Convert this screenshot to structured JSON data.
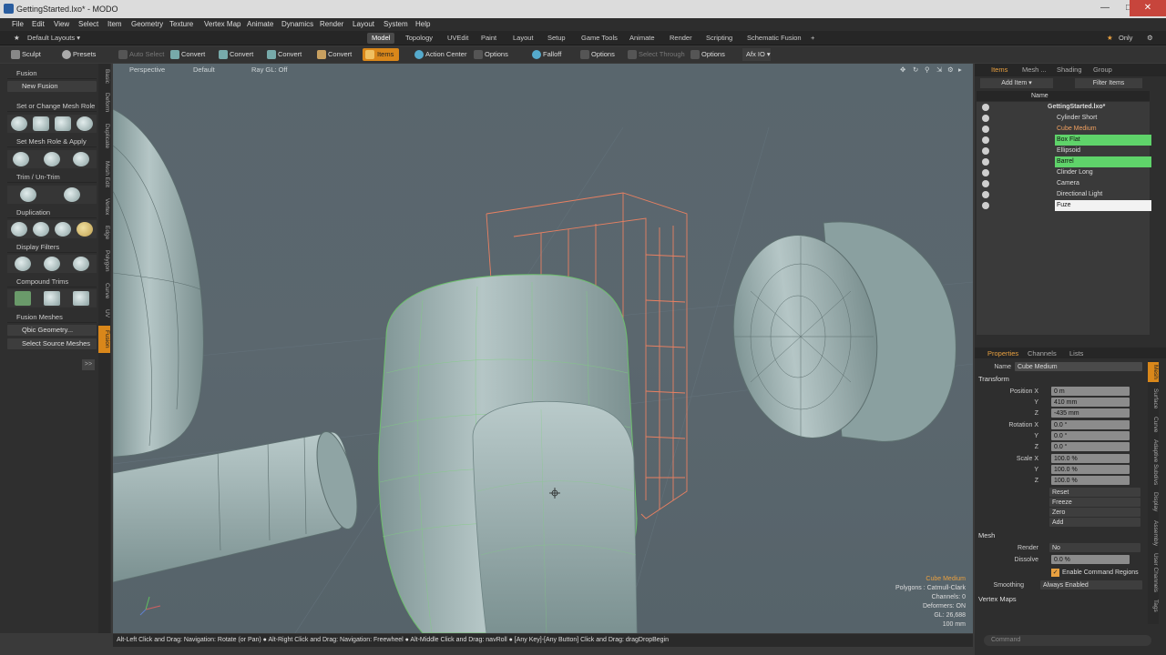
{
  "window": {
    "title": "GettingStarted.lxo* - MODO"
  },
  "menu": [
    "File",
    "Edit",
    "View",
    "Select",
    "Item",
    "Geometry",
    "Texture",
    "Vertex Map",
    "Animate",
    "Dynamics",
    "Render",
    "Layout",
    "System",
    "Help"
  ],
  "layouts": {
    "label": "Default Layouts"
  },
  "tabs": [
    "Model",
    "Topology",
    "UVEdit",
    "Paint",
    "Layout",
    "Setup",
    "Game Tools",
    "Animate",
    "Render",
    "Scripting",
    "Schematic Fusion"
  ],
  "only_label": "Only",
  "toolbar": {
    "sculpt": "Sculpt",
    "presets": "Presets",
    "auto_select": "Auto Select",
    "convert1": "Convert",
    "convert2": "Convert",
    "convert3": "Convert",
    "convert4": "Convert",
    "items": "Items",
    "action_center": "Action Center",
    "options1": "Options",
    "falloff": "Falloff",
    "options2": "Options",
    "select_through": "Select Through",
    "options3": "Options",
    "afx": "Afx IO"
  },
  "left_panel": {
    "fusion": "Fusion",
    "new_fusion": "New Fusion",
    "set_change": "Set or Change Mesh Role",
    "set_apply": "Set Mesh Role & Apply",
    "trim": "Trim / Un-Trim",
    "duplication": "Duplication",
    "display_filters": "Display Filters",
    "compound_trims": "Compound Trims",
    "fusion_meshes": "Fusion Meshes",
    "qbic": "Qbic Geometry...",
    "select_source": "Select Source Meshes"
  },
  "vertical_tabs": [
    "Basic",
    "Deform",
    "Duplicate",
    "Mesh Edit",
    "Vertex",
    "Edge",
    "Polygon",
    "Curve",
    "UV",
    "Fusion"
  ],
  "viewport": {
    "perspective": "Perspective",
    "default": "Default",
    "raygl": "Ray GL: Off",
    "info": {
      "selected": "Cube Medium",
      "polygons": "Polygons : Catmull-Clark",
      "channels": "Channels: 0",
      "deformers": "Deformers: ON",
      "gl": "GL: 26,688",
      "scale": "100 mm"
    }
  },
  "status": "Alt-Left Click and Drag: Navigation: Rotate (or Pan) ● Alt-Right Click and Drag: Navigation: Freewheel ● Alt-Middle Click and Drag: navRoll ● [Any Key]-[Any Button] Click and Drag: dragDropBegin",
  "items_panel": {
    "tabs": [
      "Items",
      "Mesh ...",
      "Shading",
      "Group"
    ],
    "add_item": "Add Item",
    "filter_items": "Filter Items",
    "col_name": "Name",
    "scene": "GettingStarted.lxo*",
    "items": [
      "Cylinder Short",
      "Cube Medium",
      "Box Flat",
      "Ellipsoid",
      "Barrel",
      "Clinder Long",
      "Camera",
      "Directional Light",
      "Fuze"
    ]
  },
  "props_panel": {
    "tabs": [
      "Properties",
      "Channels",
      "Lists"
    ],
    "name_label": "Name",
    "name_value": "Cube Medium",
    "transform": "Transform",
    "position_label": "Position X",
    "pos": [
      "0 m",
      "410 mm",
      "-435 mm"
    ],
    "rotation_label": "Rotation X",
    "rot": [
      "0.0 °",
      "0.0 °",
      "0.0 °"
    ],
    "scale_label": "Scale X",
    "scale": [
      "100.0 %",
      "100.0 %",
      "100.0 %"
    ],
    "axis_y": "Y",
    "axis_z": "Z",
    "actions": [
      "Reset",
      "Freeze",
      "Zero",
      "Add"
    ],
    "mesh": "Mesh",
    "render_label": "Render",
    "render_value": "No",
    "dissolve_label": "Dissolve",
    "dissolve_value": "0.0 %",
    "enable_cmd": "Enable Command Regions",
    "smoothing_label": "Smoothing",
    "smoothing_value": "Always Enabled",
    "vertex_maps": "Vertex Maps",
    "right_tabs": [
      "Mesh",
      "Surface",
      "Curve",
      "Adaptive Subdivs",
      "Display",
      "Assembly",
      "User Channels",
      "Tags"
    ],
    "command": "Command"
  }
}
